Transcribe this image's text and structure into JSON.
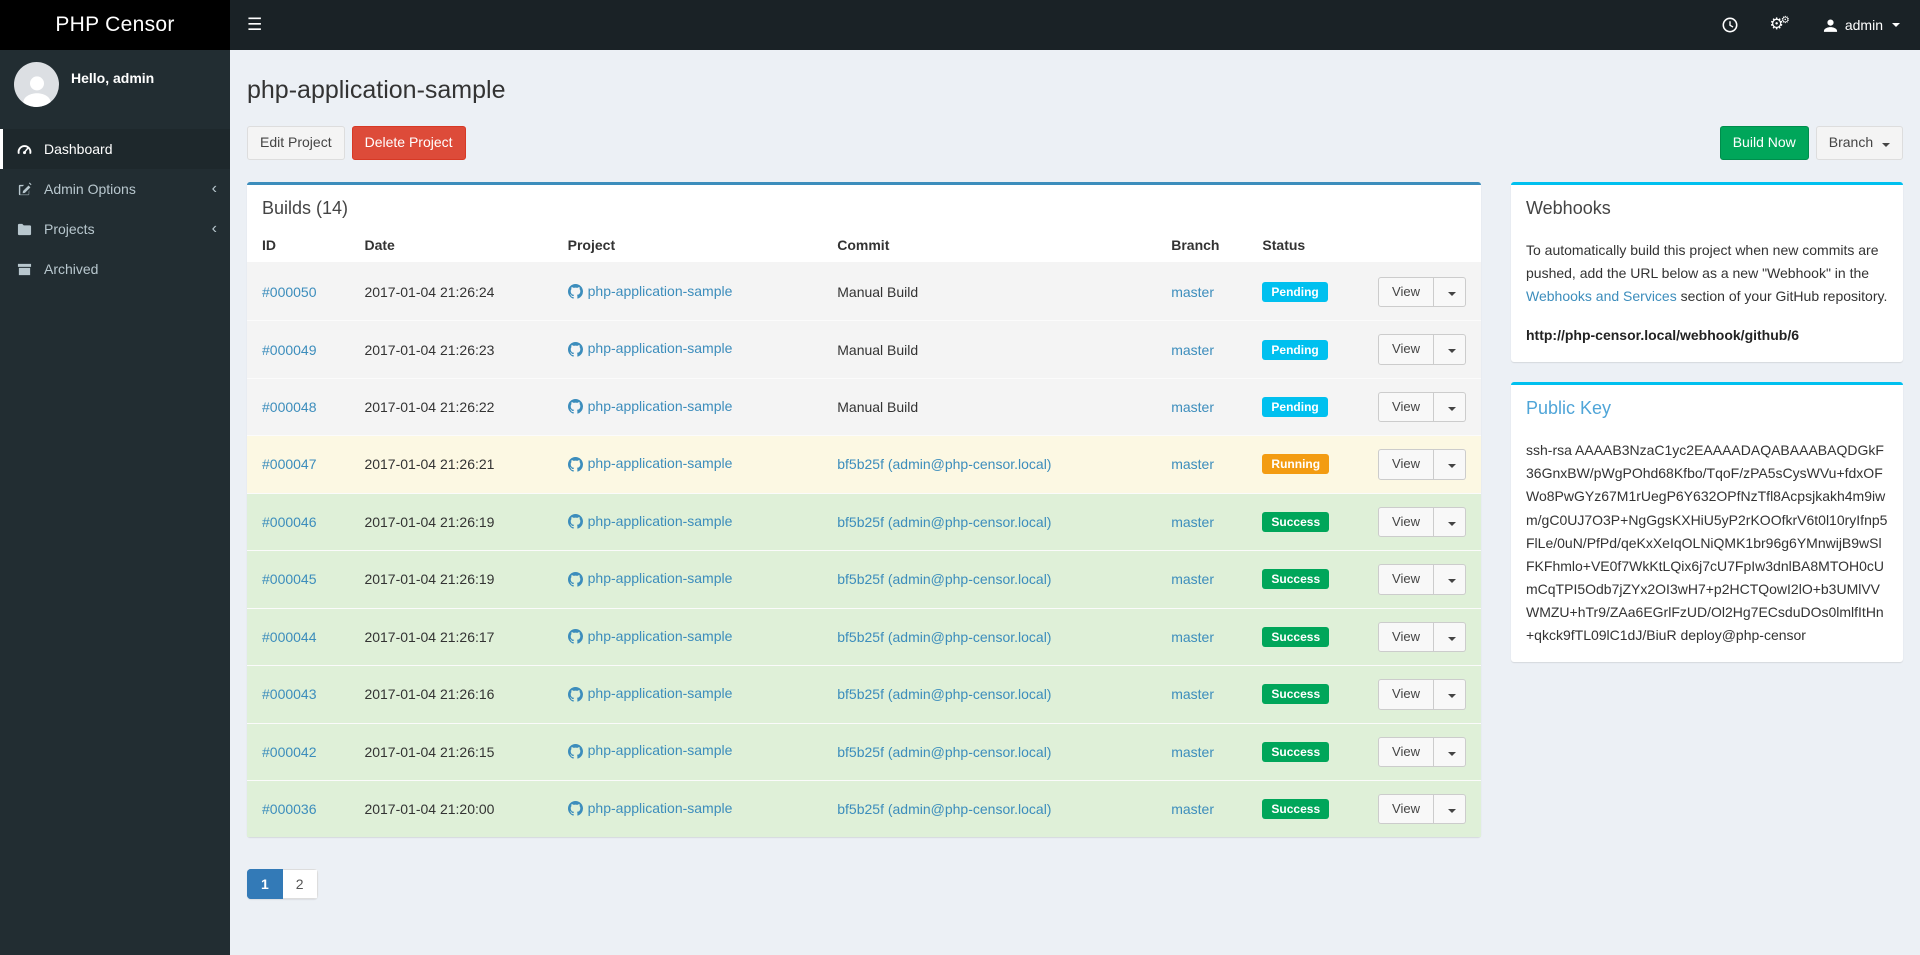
{
  "navbar": {
    "brand": "PHP Censor",
    "user_name": "admin"
  },
  "sidebar": {
    "greeting": "Hello, admin",
    "items": [
      {
        "label": "Dashboard",
        "icon": "gauge-icon",
        "active": true,
        "expandable": false
      },
      {
        "label": "Admin Options",
        "icon": "edit-icon",
        "active": false,
        "expandable": true
      },
      {
        "label": "Projects",
        "icon": "folder-icon",
        "active": false,
        "expandable": true
      },
      {
        "label": "Archived",
        "icon": "archive-icon",
        "active": false,
        "expandable": false
      }
    ]
  },
  "page": {
    "title": "php-application-sample"
  },
  "toolbar": {
    "edit_label": "Edit Project",
    "delete_label": "Delete Project",
    "build_now_label": "Build Now",
    "branch_label": "Branch"
  },
  "builds": {
    "title": "Builds (14)",
    "columns": [
      "ID",
      "Date",
      "Project",
      "Commit",
      "Branch",
      "Status"
    ],
    "view_label": "View",
    "rows": [
      {
        "id": "#000050",
        "date": "2017-01-04 21:26:24",
        "project": "php-application-sample",
        "commit": "Manual Build",
        "commit_is_link": false,
        "branch": "master",
        "status": "Pending",
        "status_color": "#00c0ef",
        "row_bg": "#f4f4f4"
      },
      {
        "id": "#000049",
        "date": "2017-01-04 21:26:23",
        "project": "php-application-sample",
        "commit": "Manual Build",
        "commit_is_link": false,
        "branch": "master",
        "status": "Pending",
        "status_color": "#00c0ef",
        "row_bg": "#f4f4f4"
      },
      {
        "id": "#000048",
        "date": "2017-01-04 21:26:22",
        "project": "php-application-sample",
        "commit": "Manual Build",
        "commit_is_link": false,
        "branch": "master",
        "status": "Pending",
        "status_color": "#00c0ef",
        "row_bg": "#f4f4f4"
      },
      {
        "id": "#000047",
        "date": "2017-01-04 21:26:21",
        "project": "php-application-sample",
        "commit": "bf5b25f (admin@php-censor.local)",
        "commit_is_link": true,
        "branch": "master",
        "status": "Running",
        "status_color": "#f39c12",
        "row_bg": "#fcf8e3"
      },
      {
        "id": "#000046",
        "date": "2017-01-04 21:26:19",
        "project": "php-application-sample",
        "commit": "bf5b25f (admin@php-censor.local)",
        "commit_is_link": true,
        "branch": "master",
        "status": "Success",
        "status_color": "#00a65a",
        "row_bg": "#dff0d8"
      },
      {
        "id": "#000045",
        "date": "2017-01-04 21:26:19",
        "project": "php-application-sample",
        "commit": "bf5b25f (admin@php-censor.local)",
        "commit_is_link": true,
        "branch": "master",
        "status": "Success",
        "status_color": "#00a65a",
        "row_bg": "#dff0d8"
      },
      {
        "id": "#000044",
        "date": "2017-01-04 21:26:17",
        "project": "php-application-sample",
        "commit": "bf5b25f (admin@php-censor.local)",
        "commit_is_link": true,
        "branch": "master",
        "status": "Success",
        "status_color": "#00a65a",
        "row_bg": "#dff0d8"
      },
      {
        "id": "#000043",
        "date": "2017-01-04 21:26:16",
        "project": "php-application-sample",
        "commit": "bf5b25f (admin@php-censor.local)",
        "commit_is_link": true,
        "branch": "master",
        "status": "Success",
        "status_color": "#00a65a",
        "row_bg": "#dff0d8"
      },
      {
        "id": "#000042",
        "date": "2017-01-04 21:26:15",
        "project": "php-application-sample",
        "commit": "bf5b25f (admin@php-censor.local)",
        "commit_is_link": true,
        "branch": "master",
        "status": "Success",
        "status_color": "#00a65a",
        "row_bg": "#dff0d8"
      },
      {
        "id": "#000036",
        "date": "2017-01-04 21:20:00",
        "project": "php-application-sample",
        "commit": "bf5b25f (admin@php-censor.local)",
        "commit_is_link": true,
        "branch": "master",
        "status": "Success",
        "status_color": "#00a65a",
        "row_bg": "#dff0d8"
      }
    ]
  },
  "pagination": {
    "pages": [
      "1",
      "2"
    ],
    "active": "1"
  },
  "webhooks": {
    "title": "Webhooks",
    "text_before_link": "To automatically build this project when new commits are pushed, add the URL below as a new \"Webhook\" in the ",
    "link_text": "Webhooks and Services",
    "text_after_link": " section of your GitHub repository.",
    "url": "http://php-censor.local/webhook/github/6"
  },
  "public_key": {
    "title": "Public Key",
    "key": "ssh-rsa AAAAB3NzaC1yc2EAAAADAQABAAABAQDGkF36GnxBW/pWgPOhd68Kfbo/TqoF/zPA5sCysWVu+fdxOFWo8PwGYz67M1rUegP6Y632OPfNzTfl8Acpsjkakh4m9iwm/gC0UJ7O3P+NgGgsKXHiU5yP2rKOOfkrV6t0l10ryIfnp5FlLe/0uN/PfPd/qeKxXeIqOLNiQMK1br96g6YMnwijB9wSlFKFhmlo+VE0f7WkKtLQix6j7cU7FpIw3dnlBA8MTOH0cUmCqTPI5Odb7jZYx2OI3wH7+p2HCTQowI2lO+b3UMlVVWMZU+hTr9/ZAa6EGrlFzUD/Ol2Hg7ECsduDOs0lmlfItHn+qkck9fTL09lC1dJ/BiuR deploy@php-censor"
  },
  "colors": {
    "primary": "#3c8dbc",
    "info": "#00c0ef",
    "success": "#00a65a",
    "warning": "#f39c12",
    "danger": "#dd4b39",
    "navbar_bg": "#1a2226",
    "sidebar_bg": "#222d32",
    "content_bg": "#ecf0f5"
  }
}
